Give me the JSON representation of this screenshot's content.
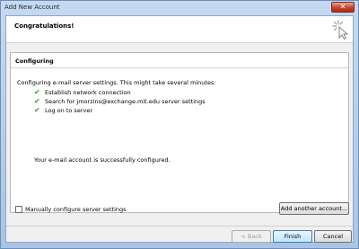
{
  "window": {
    "title": "Add New Account",
    "close_glyph": "✕"
  },
  "header": {
    "title": "Congratulations!",
    "icon": "sparkle-cursor-icon"
  },
  "configuring": {
    "section_title": "Configuring",
    "intro": "Configuring e-mail server settings. This might take several minutes:",
    "steps": [
      {
        "label": "Establish network connection",
        "status": "done"
      },
      {
        "label": "Search for jmorzins@exchange.mit.edu server settings",
        "status": "done"
      },
      {
        "label": "Log on to server",
        "status": "done"
      }
    ],
    "success": "Your e-mail account is successfully configured."
  },
  "options": {
    "manual_label": "Manually configure server settings",
    "manual_checked": false
  },
  "buttons": {
    "add_another": "Add another account...",
    "back": "< Back",
    "finish": "Finish",
    "cancel": "Cancel"
  },
  "colors": {
    "check": "#2fa128",
    "title_bg": "#b9d1ea"
  }
}
